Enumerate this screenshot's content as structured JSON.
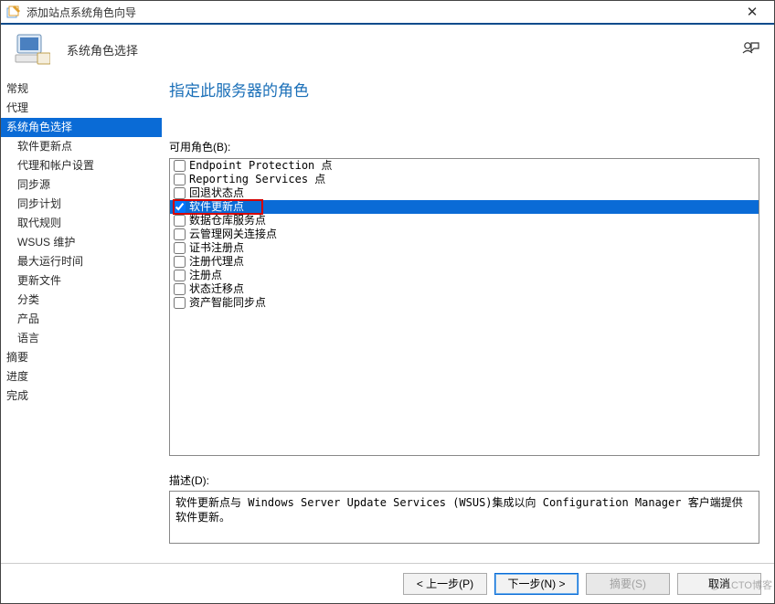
{
  "window": {
    "title": "添加站点系统角色向导",
    "close_glyph": "✕"
  },
  "header": {
    "title": "系统角色选择"
  },
  "sidebar": {
    "items": [
      {
        "label": "常规",
        "sub": false
      },
      {
        "label": "代理",
        "sub": false
      },
      {
        "label": "系统角色选择",
        "sub": false,
        "selected": true
      },
      {
        "label": "软件更新点",
        "sub": true
      },
      {
        "label": "代理和帐户设置",
        "sub": true
      },
      {
        "label": "同步源",
        "sub": true
      },
      {
        "label": "同步计划",
        "sub": true
      },
      {
        "label": "取代规则",
        "sub": true
      },
      {
        "label": "WSUS 维护",
        "sub": true
      },
      {
        "label": "最大运行时间",
        "sub": true
      },
      {
        "label": "更新文件",
        "sub": true
      },
      {
        "label": "分类",
        "sub": true
      },
      {
        "label": "产品",
        "sub": true
      },
      {
        "label": "语言",
        "sub": true
      },
      {
        "label": "摘要",
        "sub": false
      },
      {
        "label": "进度",
        "sub": false
      },
      {
        "label": "完成",
        "sub": false
      }
    ]
  },
  "main": {
    "title": "指定此服务器的角色",
    "available_label": "可用角色(B):",
    "roles": [
      {
        "label": "Endpoint Protection 点",
        "checked": false
      },
      {
        "label": "Reporting Services 点",
        "checked": false
      },
      {
        "label": "回退状态点",
        "checked": false
      },
      {
        "label": "软件更新点",
        "checked": true,
        "selected": true,
        "highlight": true
      },
      {
        "label": "数据仓库服务点",
        "checked": false
      },
      {
        "label": "云管理网关连接点",
        "checked": false
      },
      {
        "label": "证书注册点",
        "checked": false
      },
      {
        "label": "注册代理点",
        "checked": false
      },
      {
        "label": "注册点",
        "checked": false
      },
      {
        "label": "状态迁移点",
        "checked": false
      },
      {
        "label": "资产智能同步点",
        "checked": false
      }
    ],
    "description_label": "描述(D):",
    "description_text": "软件更新点与 Windows Server Update Services (WSUS)集成以向 Configuration Manager 客户端提供软件更新。"
  },
  "footer": {
    "prev": "< 上一步(P)",
    "next": "下一步(N) >",
    "summary": "摘要(S)",
    "cancel": "取消"
  },
  "watermark": "@51CTO博客"
}
